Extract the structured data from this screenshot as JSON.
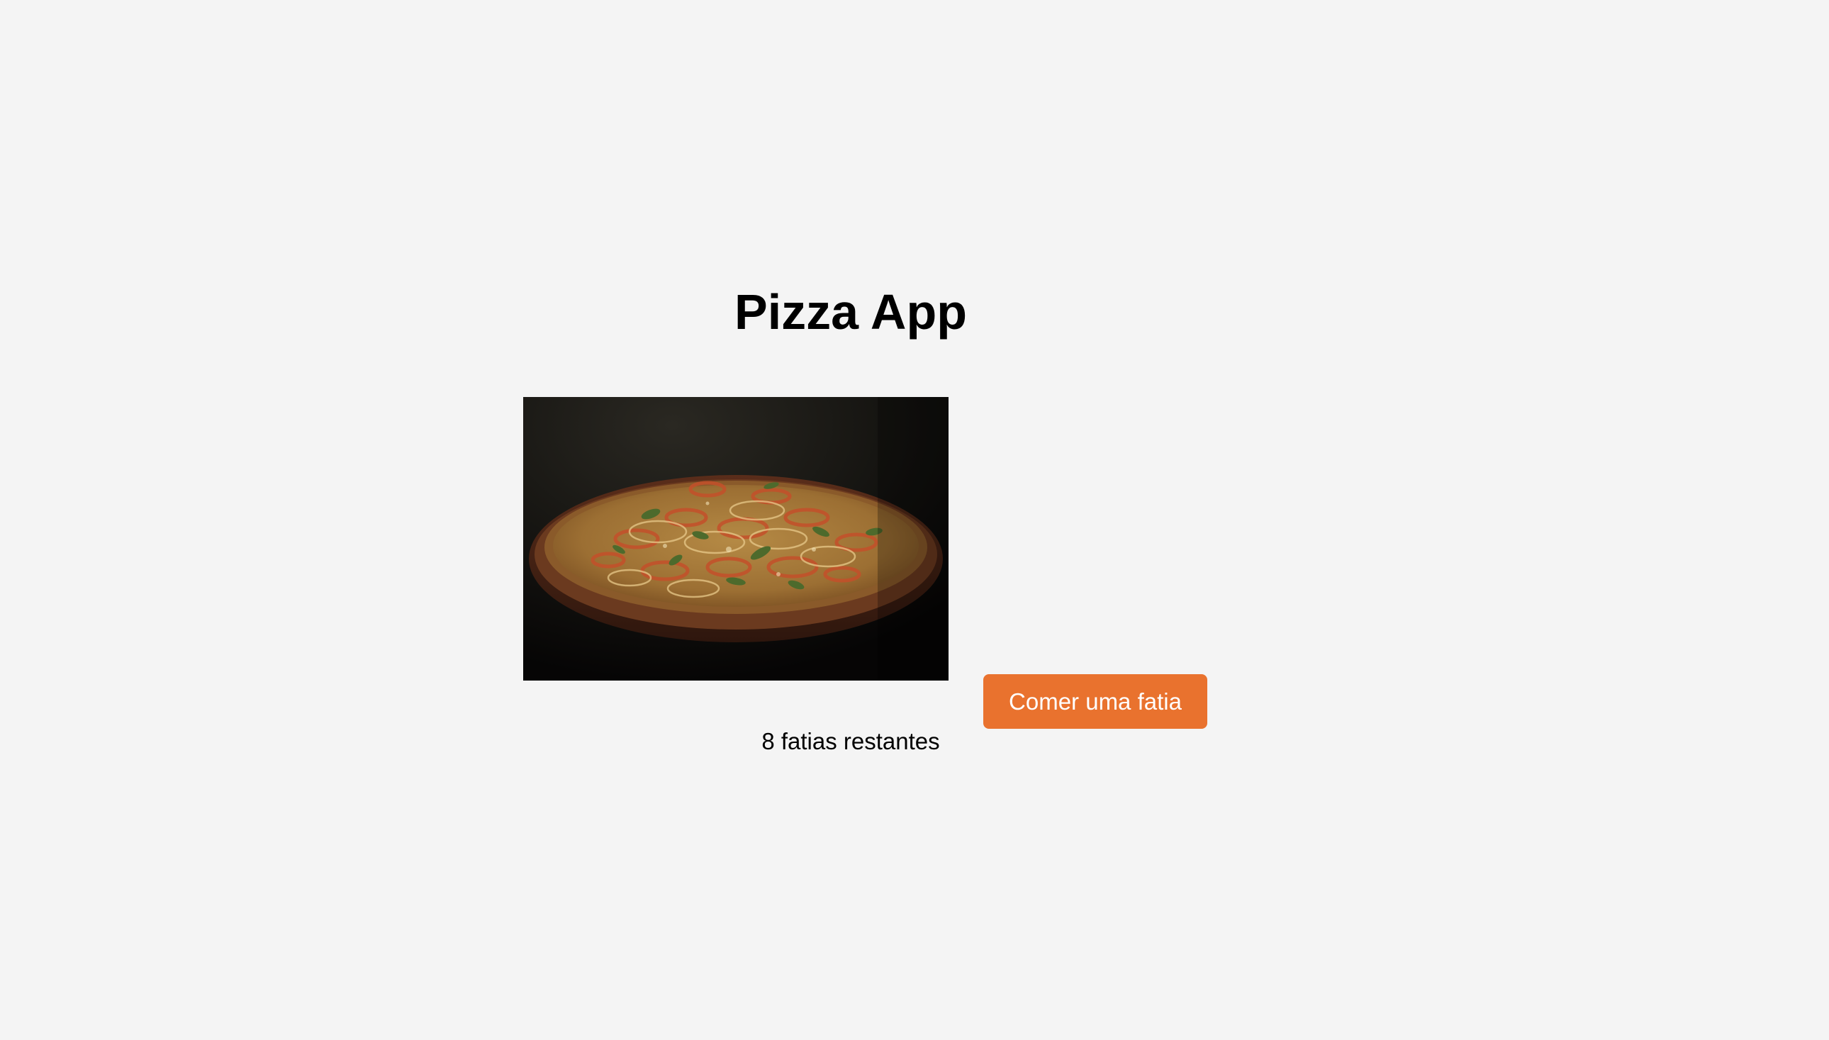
{
  "app": {
    "title": "Pizza App"
  },
  "pizza": {
    "image_icon": "pizza-photo",
    "slices_text": "8 fatias restantes"
  },
  "actions": {
    "eat_label": "Comer uma fatia"
  },
  "colors": {
    "background": "#f4f4f4",
    "accent": "#e9722e",
    "button_text": "#ffffff"
  }
}
